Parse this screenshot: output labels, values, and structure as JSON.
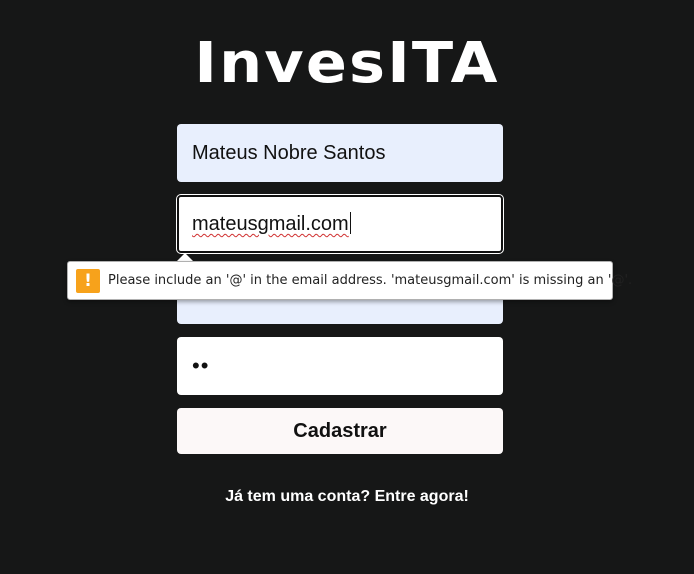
{
  "brand": {
    "logo_text": "InvesITA"
  },
  "form": {
    "name_value": "Mateus Nobre Santos",
    "email_value": "mateusgmail.com",
    "password_mask": "••",
    "submit_label": "Cadastrar"
  },
  "validation": {
    "icon": "warning-icon",
    "icon_glyph": "!",
    "message": "Please include an '@' in the email address. 'mateusgmail.com' is missing an '@'.",
    "icon_color": "#f7a21b"
  },
  "footer": {
    "login_prompt": "Já tem uma conta? Entre agora!"
  },
  "colors": {
    "background": "#161717",
    "autofill_input": "#e8effd",
    "button": "#fcf8f8"
  }
}
